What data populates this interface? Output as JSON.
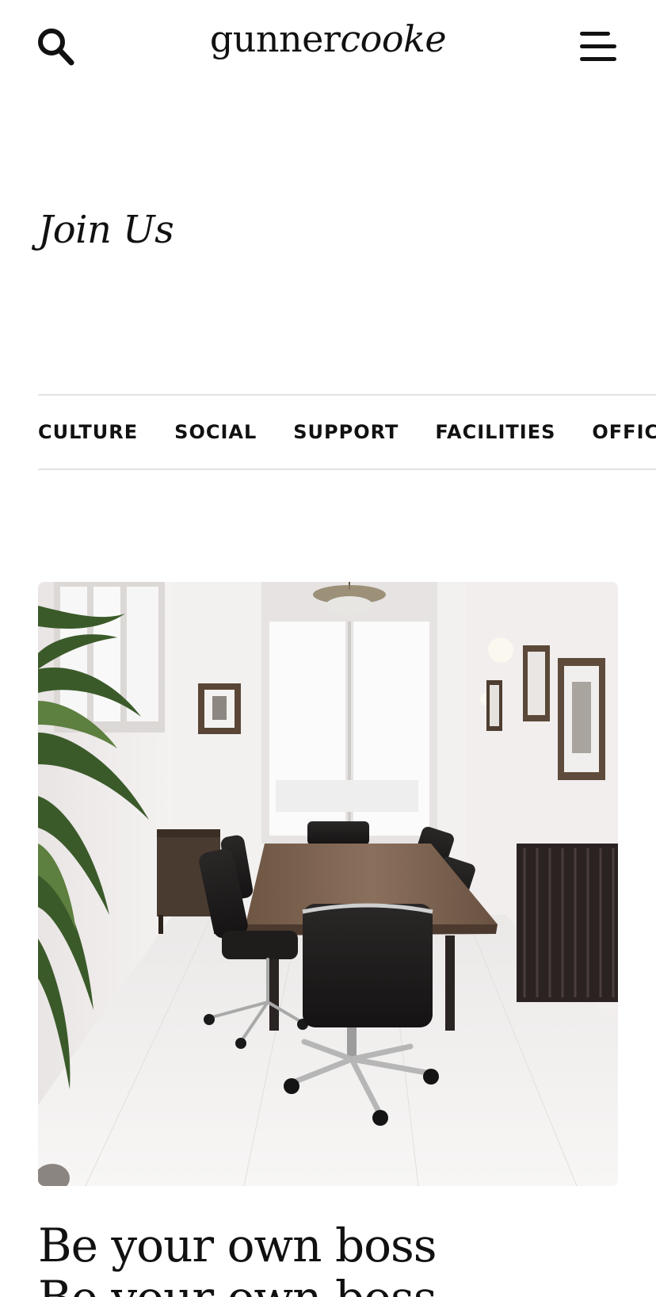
{
  "header": {
    "logo_part1": "gunner",
    "logo_part2": "cooke",
    "search_icon": "search-icon",
    "menu_icon": "hamburger-menu-icon"
  },
  "page": {
    "title": "Join Us"
  },
  "tabs": [
    {
      "label": "CULTURE"
    },
    {
      "label": "SOCIAL"
    },
    {
      "label": "SUPPORT"
    },
    {
      "label": "FACILITIES"
    },
    {
      "label": "OFFICES"
    }
  ],
  "hero": {
    "image_subject": "meeting-room-photo",
    "headline_line1": "Be your own boss",
    "headline_line2": "Be your own boss"
  },
  "colors": {
    "text": "#111111",
    "divider": "#e3e3e3",
    "background": "#ffffff"
  }
}
